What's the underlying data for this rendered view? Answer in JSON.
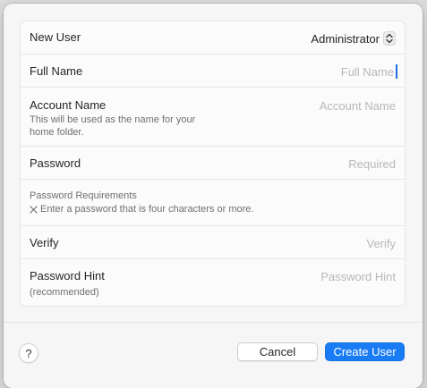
{
  "form": {
    "new_user": {
      "label": "New User",
      "value": "Administrator"
    },
    "full_name": {
      "label": "Full Name",
      "placeholder": "Full Name",
      "value": ""
    },
    "account_name": {
      "label": "Account Name",
      "description_line1": "This will be used as the name for your",
      "description_line2": "home folder.",
      "placeholder": "Account Name",
      "value": ""
    },
    "password": {
      "label": "Password",
      "placeholder": "Required",
      "value": ""
    },
    "password_requirements": {
      "title": "Password Requirements",
      "rule": "Enter a password that is four characters or more."
    },
    "verify": {
      "label": "Verify",
      "placeholder": "Verify",
      "value": ""
    },
    "password_hint": {
      "label": "Password Hint",
      "note": "(recommended)",
      "placeholder": "Password Hint",
      "value": ""
    }
  },
  "footer": {
    "help_label": "?",
    "cancel_label": "Cancel",
    "create_label": "Create User"
  },
  "colors": {
    "accent": "#1a7cf5",
    "caret": "#1c6fe0"
  },
  "icons": {
    "popup": "up-down-chevrons-icon",
    "requirement_status": "x-mark-icon"
  }
}
